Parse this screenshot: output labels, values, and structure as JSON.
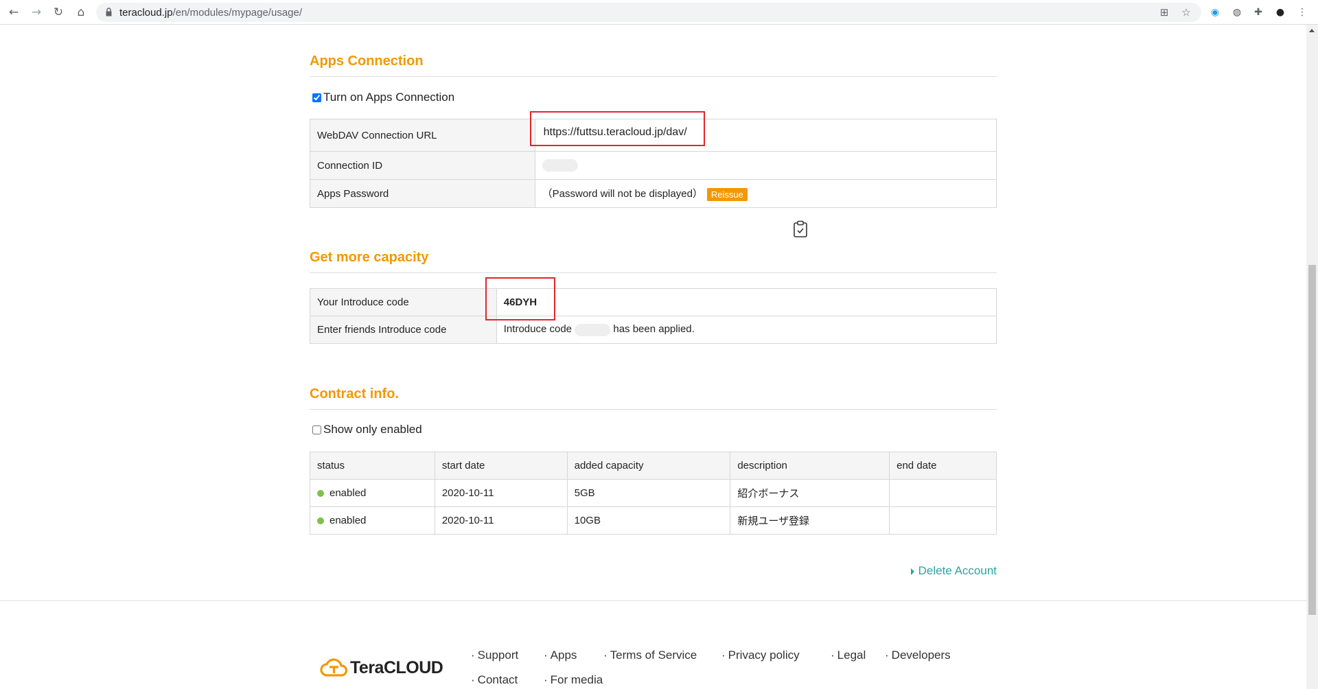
{
  "browser": {
    "url_host": "teracloud.jp",
    "url_path": "/en/modules/mypage/usage/"
  },
  "apps_connection": {
    "title": "Apps Connection",
    "toggle_label": "Turn on Apps Connection",
    "toggle_checked": true,
    "rows": {
      "webdav_label": "WebDAV Connection URL",
      "webdav_value": "https://futtsu.teracloud.jp/dav/",
      "connection_id_label": "Connection ID",
      "apps_password_label": "Apps Password",
      "apps_password_value": "（Password will not be displayed）",
      "reissue_label": "Reissue"
    }
  },
  "capacity": {
    "title": "Get more capacity",
    "introduce_label": "Your Introduce code",
    "introduce_value": "46DYH",
    "friends_label": "Enter friends Introduce code",
    "friends_prefix": "Introduce code",
    "friends_suffix": "has been applied."
  },
  "contract": {
    "title": "Contract info.",
    "filter_label": "Show only enabled",
    "filter_checked": false,
    "columns": [
      "status",
      "start date",
      "added capacity",
      "description",
      "end date"
    ],
    "rows": [
      {
        "status": "enabled",
        "start": "2020-10-11",
        "capacity": "5GB",
        "description": "紹介ボーナス",
        "end": ""
      },
      {
        "status": "enabled",
        "start": "2020-10-11",
        "capacity": "10GB",
        "description": "新規ユーザ登録",
        "end": ""
      }
    ]
  },
  "delete_account": "Delete Account",
  "footer": {
    "logo_text": "TeraCLOUD",
    "links": [
      "Support",
      "Apps",
      "Terms of Service",
      "Privacy policy",
      "Legal",
      "Developers",
      "Contact",
      "For media"
    ]
  },
  "colors": {
    "accent": "#f39800",
    "link": "#2aa5a0",
    "status_enabled": "#7ec147",
    "highlight": "#e0262b"
  }
}
